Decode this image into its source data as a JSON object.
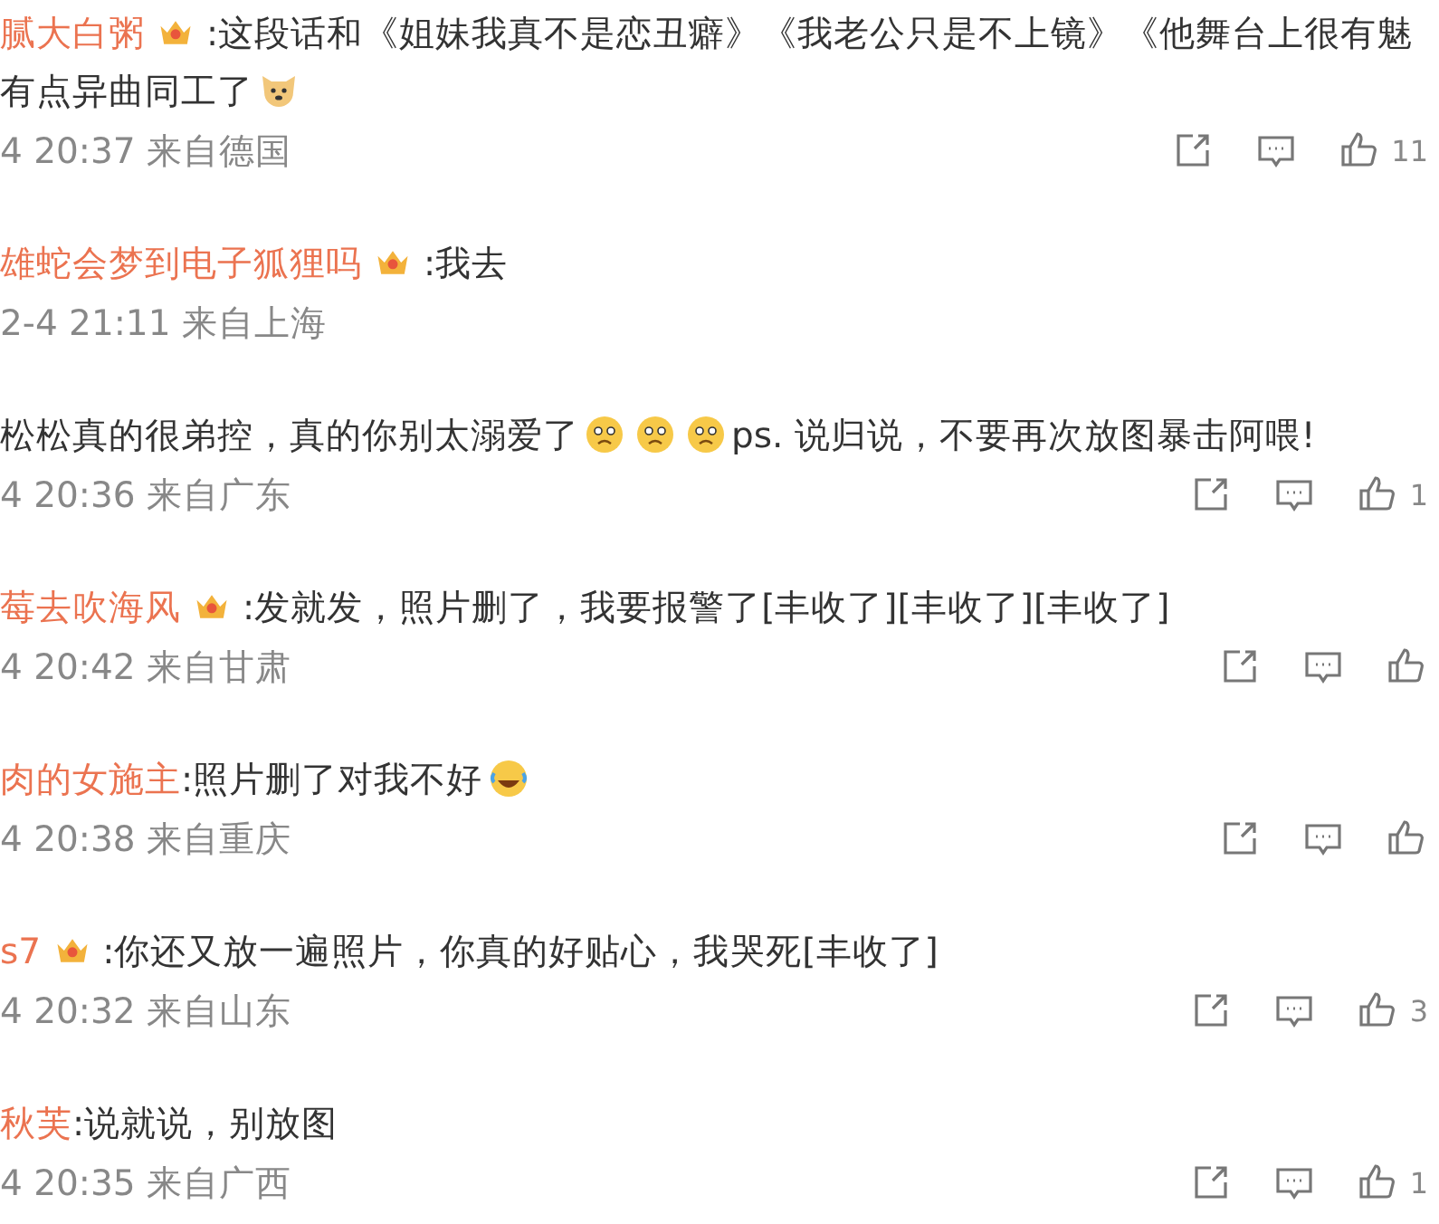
{
  "comments": [
    {
      "lines": [
        [
          {
            "kind": "user",
            "text": "腻大白粥"
          },
          {
            "kind": "badge"
          },
          {
            "kind": "text",
            "text": ":这段话和《姐妹我真不是恋丑癖》《我老公只是不上镜》《他舞台上很有魅"
          }
        ],
        [
          {
            "kind": "text",
            "text": "有点异曲同工了"
          },
          {
            "kind": "dog"
          }
        ]
      ],
      "meta": "4 20:37 来自德国",
      "actions": true,
      "likes": "11"
    },
    {
      "lines": [
        [
          {
            "kind": "user",
            "text": "雄蛇会梦到电子狐狸吗"
          },
          {
            "kind": "badge"
          },
          {
            "kind": "text",
            "text": ":我去"
          }
        ]
      ],
      "meta": "2-4 21:11 来自上海",
      "actions": false
    },
    {
      "lines": [
        [
          {
            "kind": "text",
            "text": "松松真的很弟控，真的你别太溺爱了"
          },
          {
            "kind": "sad"
          },
          {
            "kind": "sad"
          },
          {
            "kind": "sad"
          },
          {
            "kind": "text",
            "text": " ps. 说归说，不要再次放图暴击阿喂!"
          }
        ]
      ],
      "meta": "4 20:36 来自广东",
      "actions": true,
      "likes": "1"
    },
    {
      "lines": [
        [
          {
            "kind": "user",
            "text": "莓去吹海风"
          },
          {
            "kind": "badge"
          },
          {
            "kind": "text",
            "text": ":发就发，照片删了，我要报警了[丰收了][丰收了][丰收了]"
          }
        ]
      ],
      "meta": "4 20:42 来自甘肃",
      "actions": true
    },
    {
      "lines": [
        [
          {
            "kind": "user",
            "text": "肉的女施主"
          },
          {
            "kind": "text",
            "text": ":照片删了对我不好"
          },
          {
            "kind": "laugh"
          }
        ]
      ],
      "meta": "4 20:38 来自重庆",
      "actions": true
    },
    {
      "lines": [
        [
          {
            "kind": "user",
            "text": "s7"
          },
          {
            "kind": "badge"
          },
          {
            "kind": "text",
            "text": ":你还又放一遍照片，你真的好贴心，我哭死[丰收了]"
          }
        ]
      ],
      "meta": "4 20:32 来自山东",
      "actions": true,
      "likes": "3"
    },
    {
      "lines": [
        [
          {
            "kind": "user",
            "text": "秋芙"
          },
          {
            "kind": "text",
            "text": ":说就说，别放图"
          }
        ]
      ],
      "meta": "4 20:35 来自广西",
      "actions": true,
      "likes": "1"
    }
  ]
}
